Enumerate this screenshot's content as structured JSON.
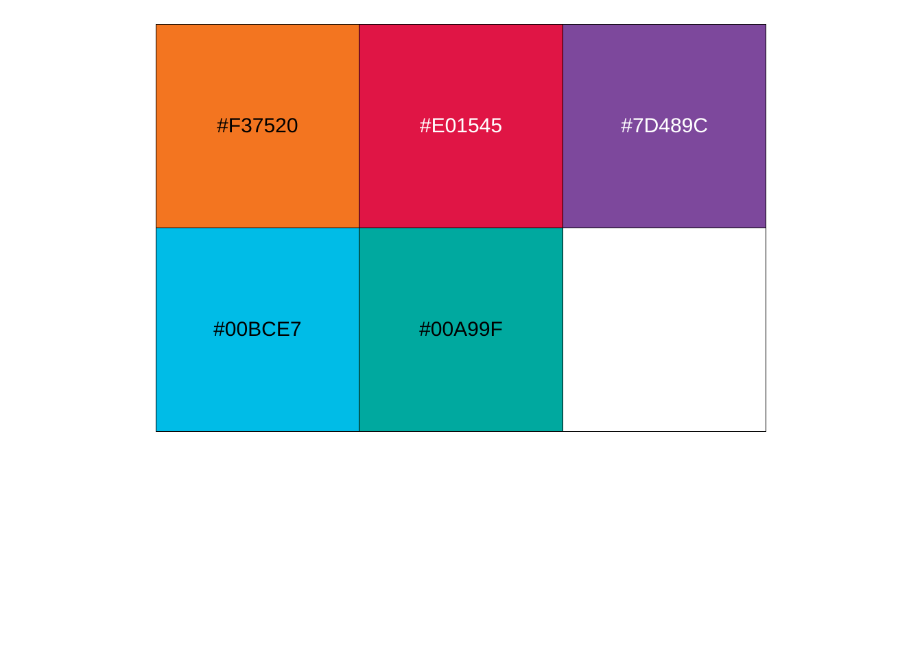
{
  "palette": {
    "swatches": [
      {
        "label": "#F37520",
        "color": "#F37520",
        "text_color": "#000000"
      },
      {
        "label": "#E01545",
        "color": "#E01545",
        "text_color": "#FFFFFF"
      },
      {
        "label": "#7D489C",
        "color": "#7D489C",
        "text_color": "#FFFFFF"
      },
      {
        "label": "#00BCE7",
        "color": "#00BCE7",
        "text_color": "#000000"
      },
      {
        "label": "#00A99F",
        "color": "#00A99F",
        "text_color": "#000000"
      },
      {
        "label": "",
        "color": "#FFFFFF",
        "text_color": "#000000"
      }
    ]
  }
}
